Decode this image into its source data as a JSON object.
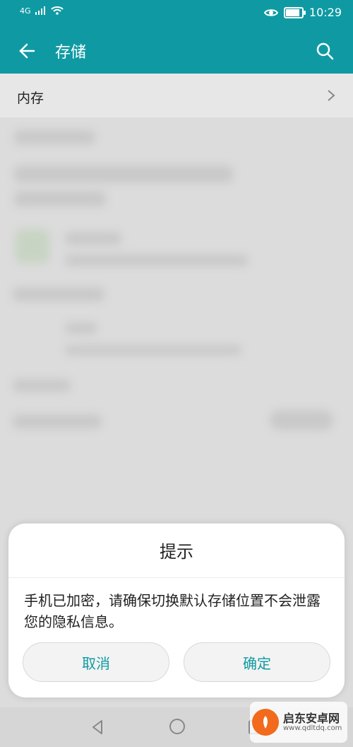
{
  "status_bar": {
    "network": "4G",
    "time": "10:29",
    "battery_level": 0.85
  },
  "app_bar": {
    "title": "存储"
  },
  "storage": {
    "row_label": "内存"
  },
  "dialog": {
    "title": "提示",
    "message": "手机已加密，请确保切换默认存储位置不会泄露您的隐私信息。",
    "cancel_label": "取消",
    "ok_label": "确定"
  },
  "watermark": {
    "title": "启东安卓网",
    "url": "www.qdltdq.com"
  },
  "icons": {
    "back": "back-arrow-icon",
    "search": "search-icon",
    "chevron": "chevron-right-icon",
    "nav_back": "nav-back-icon",
    "nav_home": "nav-home-icon",
    "nav_recent": "nav-recent-icon",
    "eye": "eye-icon",
    "wifi": "wifi-icon",
    "signal": "signal-icon"
  },
  "colors": {
    "accent": "#0f9aa3",
    "background": "#dcdcdc",
    "dialog": "#ffffff"
  }
}
